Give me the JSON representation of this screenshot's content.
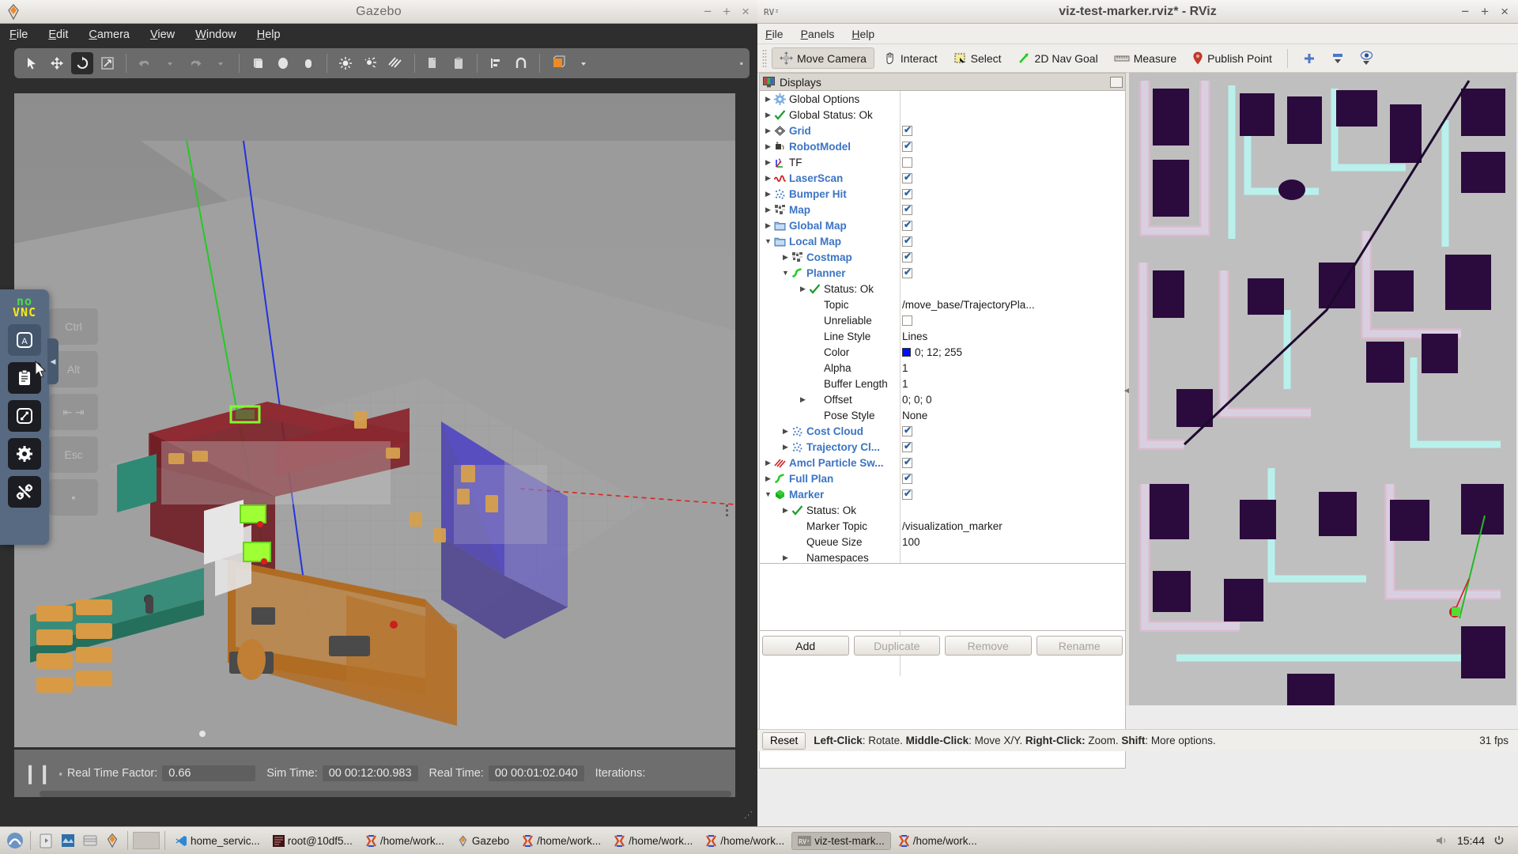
{
  "gazebo": {
    "title": "Gazebo",
    "app_icon": "gazebo-icon",
    "window_buttons": [
      "−",
      "+",
      "×"
    ],
    "menu": [
      "File",
      "Edit",
      "Camera",
      "View",
      "Window",
      "Help"
    ],
    "toolbar": [
      {
        "name": "select-tool",
        "active": false
      },
      {
        "name": "translate-tool",
        "active": false
      },
      {
        "name": "rotate-tool",
        "active": true
      },
      {
        "name": "scale-tool",
        "active": false
      },
      {
        "name": "undo-tool",
        "active": false
      },
      {
        "name": "undo-dropdown",
        "active": false
      },
      {
        "name": "redo-tool",
        "active": false
      },
      {
        "name": "redo-dropdown",
        "active": false
      },
      {
        "name": "box-tool",
        "active": false
      },
      {
        "name": "sphere-tool",
        "active": false
      },
      {
        "name": "cylinder-tool",
        "active": false
      },
      {
        "name": "point-light-tool",
        "active": false
      },
      {
        "name": "spot-light-tool",
        "active": false
      },
      {
        "name": "directional-light-tool",
        "active": false
      },
      {
        "name": "copy-tool",
        "active": false
      },
      {
        "name": "paste-tool",
        "active": false
      },
      {
        "name": "align-tool",
        "active": false
      },
      {
        "name": "snap-tool",
        "active": false
      },
      {
        "name": "view-mode-tool",
        "active": false
      }
    ],
    "status": {
      "real_time_factor_label": "Real Time Factor:",
      "real_time_factor_value": "0.66",
      "sim_time_label": "Sim Time:",
      "sim_time_value": "00 00:12:00.983",
      "real_time_label": "Real Time:",
      "real_time_value": "00 00:01:02.040",
      "iterations_label": "Iterations:"
    }
  },
  "rviz": {
    "title": "viz-test-marker.rviz* - RViz",
    "window_buttons": [
      "−",
      "+",
      "×"
    ],
    "menu": [
      "File",
      "Panels",
      "Help"
    ],
    "toolbar": [
      {
        "label": "Move Camera",
        "icon": "move-camera-icon",
        "active": true
      },
      {
        "label": "Interact",
        "icon": "interact-hand-icon",
        "active": false
      },
      {
        "label": "Select",
        "icon": "select-rect-icon",
        "active": false
      },
      {
        "label": "2D Nav Goal",
        "icon": "nav-goal-arrow-icon",
        "active": false
      },
      {
        "label": "Measure",
        "icon": "measure-ruler-icon",
        "active": false
      },
      {
        "label": "Publish Point",
        "icon": "map-pin-icon",
        "active": false
      }
    ],
    "toolbar_right": [
      {
        "name": "add-tool-icon",
        "glyph": "+"
      },
      {
        "name": "remove-tool-icon",
        "glyph": "−"
      },
      {
        "name": "tool-properties-icon",
        "glyph": "◉"
      }
    ],
    "displays_panel": {
      "header": "Displays",
      "header_icon": "displays-icon",
      "tree": [
        {
          "indent": 0,
          "arrow": "right",
          "icon": "gear-icon",
          "label": "Global Options",
          "style": "plain",
          "value_type": "none"
        },
        {
          "indent": 0,
          "arrow": "right",
          "icon": "check-icon",
          "label": "Global Status: Ok",
          "style": "plain",
          "value_type": "none"
        },
        {
          "indent": 0,
          "arrow": "right",
          "icon": "grid-icon",
          "label": "Grid",
          "style": "display",
          "value_type": "checkbox",
          "checked": true
        },
        {
          "indent": 0,
          "arrow": "right",
          "icon": "robot-icon",
          "label": "RobotModel",
          "style": "display",
          "value_type": "checkbox",
          "checked": true
        },
        {
          "indent": 0,
          "arrow": "right",
          "icon": "tf-axes-icon",
          "label": "TF",
          "style": "plain",
          "value_type": "checkbox",
          "checked": false
        },
        {
          "indent": 0,
          "arrow": "right",
          "icon": "laserscan-icon",
          "label": "LaserScan",
          "style": "display",
          "value_type": "checkbox",
          "checked": true
        },
        {
          "indent": 0,
          "arrow": "right",
          "icon": "pointcloud-icon",
          "label": "Bumper Hit",
          "style": "display",
          "value_type": "checkbox",
          "checked": true
        },
        {
          "indent": 0,
          "arrow": "right",
          "icon": "map-icon",
          "label": "Map",
          "style": "display",
          "value_type": "checkbox",
          "checked": true
        },
        {
          "indent": 0,
          "arrow": "right",
          "icon": "group-icon",
          "label": "Global Map",
          "style": "display",
          "value_type": "checkbox",
          "checked": true
        },
        {
          "indent": 0,
          "arrow": "down",
          "icon": "group-icon",
          "label": "Local Map",
          "style": "display",
          "value_type": "checkbox",
          "checked": true
        },
        {
          "indent": 1,
          "arrow": "right",
          "icon": "map-icon",
          "label": "Costmap",
          "style": "display",
          "value_type": "checkbox",
          "checked": true
        },
        {
          "indent": 1,
          "arrow": "down",
          "icon": "path-icon",
          "label": "Planner",
          "style": "display",
          "value_type": "checkbox",
          "checked": true
        },
        {
          "indent": 2,
          "arrow": "right",
          "icon": "check-icon",
          "label": "Status: Ok",
          "style": "plain",
          "value_type": "none"
        },
        {
          "indent": 2,
          "arrow": "none",
          "icon": "none",
          "label": "Topic",
          "style": "plain",
          "value_type": "text",
          "value": "/move_base/TrajectoryPla..."
        },
        {
          "indent": 2,
          "arrow": "none",
          "icon": "none",
          "label": "Unreliable",
          "style": "plain",
          "value_type": "checkbox",
          "checked": false
        },
        {
          "indent": 2,
          "arrow": "none",
          "icon": "none",
          "label": "Line Style",
          "style": "plain",
          "value_type": "text",
          "value": "Lines"
        },
        {
          "indent": 2,
          "arrow": "none",
          "icon": "none",
          "label": "Color",
          "style": "plain",
          "value_type": "color",
          "value": "0; 12; 255",
          "color": "#000cff"
        },
        {
          "indent": 2,
          "arrow": "none",
          "icon": "none",
          "label": "Alpha",
          "style": "plain",
          "value_type": "text",
          "value": "1"
        },
        {
          "indent": 2,
          "arrow": "none",
          "icon": "none",
          "label": "Buffer Length",
          "style": "plain",
          "value_type": "text",
          "value": "1"
        },
        {
          "indent": 2,
          "arrow": "right",
          "icon": "none",
          "label": "Offset",
          "style": "plain",
          "value_type": "text",
          "value": "0; 0; 0"
        },
        {
          "indent": 2,
          "arrow": "none",
          "icon": "none",
          "label": "Pose Style",
          "style": "plain",
          "value_type": "text",
          "value": "None"
        },
        {
          "indent": 1,
          "arrow": "right",
          "icon": "pointcloud-icon",
          "label": "Cost Cloud",
          "style": "display",
          "value_type": "checkbox",
          "checked": true
        },
        {
          "indent": 1,
          "arrow": "right",
          "icon": "pointcloud-icon",
          "label": "Trajectory Cl...",
          "style": "display",
          "value_type": "checkbox",
          "checked": true
        },
        {
          "indent": 0,
          "arrow": "right",
          "icon": "particles-icon",
          "label": "Amcl Particle Sw...",
          "style": "display",
          "value_type": "checkbox",
          "checked": true
        },
        {
          "indent": 0,
          "arrow": "right",
          "icon": "path-icon",
          "label": "Full Plan",
          "style": "display",
          "value_type": "checkbox",
          "checked": true
        },
        {
          "indent": 0,
          "arrow": "down",
          "icon": "marker-cube-icon",
          "label": "Marker",
          "style": "display",
          "value_type": "checkbox",
          "checked": true
        },
        {
          "indent": 1,
          "arrow": "right",
          "icon": "check-icon",
          "label": "Status: Ok",
          "style": "plain",
          "value_type": "none"
        },
        {
          "indent": 1,
          "arrow": "none",
          "icon": "none",
          "label": "Marker Topic",
          "style": "plain",
          "value_type": "text",
          "value": "/visualization_marker"
        },
        {
          "indent": 1,
          "arrow": "none",
          "icon": "none",
          "label": "Queue Size",
          "style": "plain",
          "value_type": "text",
          "value": "100"
        },
        {
          "indent": 1,
          "arrow": "right",
          "icon": "none",
          "label": "Namespaces",
          "style": "plain",
          "value_type": "none"
        }
      ],
      "buttons": [
        {
          "label": "Add",
          "enabled": true
        },
        {
          "label": "Duplicate",
          "enabled": false
        },
        {
          "label": "Remove",
          "enabled": false
        },
        {
          "label": "Rename",
          "enabled": false
        }
      ]
    },
    "status_bar": {
      "reset_label": "Reset",
      "hint_segments": [
        {
          "text": "Left-Click",
          "bold": true
        },
        {
          "text": ": Rotate.  ",
          "bold": false
        },
        {
          "text": "Middle-Click",
          "bold": true
        },
        {
          "text": ": Move X/Y.  ",
          "bold": false
        },
        {
          "text": "Right-Click:",
          "bold": true
        },
        {
          "text": " Zoom.  ",
          "bold": false
        },
        {
          "text": "Shift",
          "bold": true
        },
        {
          "text": ": More options.",
          "bold": false
        }
      ],
      "fps": "31 fps"
    }
  },
  "novnc": {
    "logo_top": "no",
    "logo_bottom": "VNC",
    "buttons": [
      {
        "name": "keyboard-icon",
        "selected": true
      },
      {
        "name": "clipboard-icon",
        "selected": false
      },
      {
        "name": "fullscreen-icon",
        "selected": false
      },
      {
        "name": "settings-gear-icon",
        "selected": false
      },
      {
        "name": "disconnect-icon",
        "selected": false
      }
    ],
    "ghost_keys": [
      "Ctrl",
      "Alt",
      "Tab",
      "Esc",
      ""
    ]
  },
  "taskbar": {
    "launchers": [
      "ubuntu-logo-icon",
      "files-icon",
      "browser-icon",
      "window-list-icon",
      "gazebo-icon"
    ],
    "items": [
      {
        "label": "home_servic...",
        "icon": "vscode-icon",
        "active": false
      },
      {
        "label": "root@10df5...",
        "icon": "terminal-icon",
        "active": false
      },
      {
        "label": "/home/work...",
        "icon": "xterm-icon",
        "active": false
      },
      {
        "label": "Gazebo",
        "icon": "gazebo-icon",
        "active": false
      },
      {
        "label": "/home/work...",
        "icon": "xterm-icon",
        "active": false
      },
      {
        "label": "/home/work...",
        "icon": "xterm-icon",
        "active": false
      },
      {
        "label": "/home/work...",
        "icon": "xterm-icon",
        "active": false
      },
      {
        "label": "viz-test-mark...",
        "icon": "rviz-icon",
        "active": true
      },
      {
        "label": "/home/work...",
        "icon": "xterm-icon",
        "active": false
      }
    ],
    "clock": "15:44",
    "tray": [
      "volume-icon",
      "power-icon"
    ]
  }
}
